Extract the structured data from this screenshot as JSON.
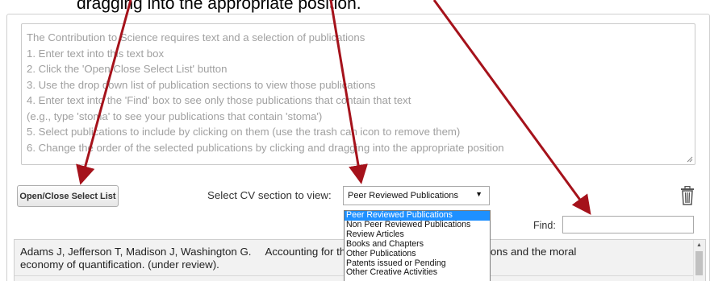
{
  "caption": "dragging into the appropriate position.",
  "instructions": [
    "The Contribution to Science requires text and a selection of publications",
    "1. Enter text into this text box",
    "2. Click the 'Open/Close Select List' button",
    "3. Use the drop down list of publication sections to view those publications",
    "4. Enter text into the 'Find' box to see only those publications that contain that text",
    "(e.g., type 'stoma' to see your publications that contain 'stoma')",
    "5. Select publications to include by clicking on them (use the trash can icon to remove them)",
    "6. Change the order of the selected publications by clicking and dragging into the appropriate position"
  ],
  "toolbar": {
    "open_close_label": "Open/Close Select List",
    "section_label": "Select CV section to view:",
    "selected_section": "Peer Reviewed Publications",
    "find_label": "Find:",
    "find_value": ""
  },
  "sections": [
    "Peer Reviewed Publications",
    "Non Peer Reviewed Publications",
    "Review Articles",
    "Books and Chapters",
    "Other Publications",
    "Patents issued or Pending",
    "Other Creative Activities"
  ],
  "publication": {
    "authors": "Adams J, Jefferson T, Madison J, Washington G.",
    "title_line1": "Accounting for the human-environment interactions and the moral",
    "title_line2": "economy of quantification. (under review)."
  },
  "colors": {
    "arrow": "#a5121b",
    "selected_option": "#1e90ff"
  },
  "icons": {
    "trash": "trash-icon",
    "caret": "caret-down-icon",
    "resize": "resize-grip-icon"
  }
}
